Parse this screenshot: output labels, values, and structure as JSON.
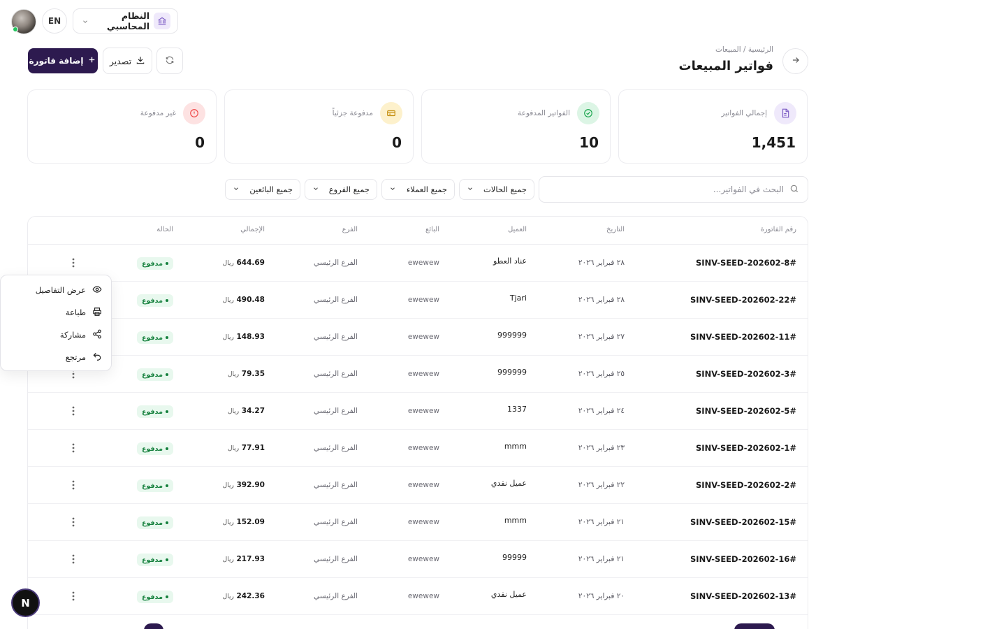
{
  "topbar": {
    "lang_label": "EN",
    "system_label": "النظام المحاسبي"
  },
  "header": {
    "breadcrumb": "الرئيسية / المبيعات",
    "title": "فواتير المبيعات",
    "export_label": "تصدير",
    "add_label": "إضافة فاتورة"
  },
  "stats": [
    {
      "label": "إجمالي الفواتير",
      "value": "1,451",
      "color": "#7c5cc4"
    },
    {
      "label": "الفواتير المدفوعة",
      "value": "10",
      "color": "#16a34a"
    },
    {
      "label": "مدفوعة جزئياً",
      "value": "0",
      "color": "#d4a017"
    },
    {
      "label": "غير مدفوعة",
      "value": "0",
      "color": "#ef4444"
    }
  ],
  "filters": {
    "search_placeholder": "البحث في الفواتير...",
    "status": "جميع الحالات",
    "customers": "جميع العملاء",
    "branches": "جميع الفروع",
    "sellers": "جميع البائعين"
  },
  "table": {
    "headers": {
      "invoice": "رقم الفاتورة",
      "date": "التاريخ",
      "customer": "العميل",
      "seller": "البائع",
      "branch": "الفرع",
      "total": "الإجمالي",
      "status": "الحالة"
    },
    "currency": "ريال",
    "rows": [
      {
        "invoice": "SINV-SEED-202602-8#",
        "date": "٢٨ فبراير ٢٠٢٦",
        "customer": "عناد العطو",
        "seller": "ewewew",
        "branch": "الفرع الرئيسي",
        "total": "644.69",
        "status": "مدفوع"
      },
      {
        "invoice": "SINV-SEED-202602-22#",
        "date": "٢٨ فبراير ٢٠٢٦",
        "customer": "Tjari",
        "seller": "ewewew",
        "branch": "الفرع الرئيسي",
        "total": "490.48",
        "status": "مدفوع"
      },
      {
        "invoice": "SINV-SEED-202602-11#",
        "date": "٢٧ فبراير ٢٠٢٦",
        "customer": "999999",
        "seller": "ewewew",
        "branch": "الفرع الرئيسي",
        "total": "148.93",
        "status": "مدفوع"
      },
      {
        "invoice": "SINV-SEED-202602-3#",
        "date": "٢٥ فبراير ٢٠٢٦",
        "customer": "999999",
        "seller": "ewewew",
        "branch": "الفرع الرئيسي",
        "total": "79.35",
        "status": "مدفوع"
      },
      {
        "invoice": "SINV-SEED-202602-5#",
        "date": "٢٤ فبراير ٢٠٢٦",
        "customer": "1337",
        "seller": "ewewew",
        "branch": "الفرع الرئيسي",
        "total": "34.27",
        "status": "مدفوع"
      },
      {
        "invoice": "SINV-SEED-202602-1#",
        "date": "٢٣ فبراير ٢٠٢٦",
        "customer": "mmm",
        "seller": "ewewew",
        "branch": "الفرع الرئيسي",
        "total": "77.91",
        "status": "مدفوع"
      },
      {
        "invoice": "SINV-SEED-202602-2#",
        "date": "٢٢ فبراير ٢٠٢٦",
        "customer": "عميل نقدي",
        "seller": "ewewew",
        "branch": "الفرع الرئيسي",
        "total": "392.90",
        "status": "مدفوع"
      },
      {
        "invoice": "SINV-SEED-202602-15#",
        "date": "٢١ فبراير ٢٠٢٦",
        "customer": "mmm",
        "seller": "ewewew",
        "branch": "الفرع الرئيسي",
        "total": "152.09",
        "status": "مدفوع"
      },
      {
        "invoice": "SINV-SEED-202602-16#",
        "date": "٢١ فبراير ٢٠٢٦",
        "customer": "99999",
        "seller": "ewewew",
        "branch": "الفرع الرئيسي",
        "total": "217.93",
        "status": "مدفوع"
      },
      {
        "invoice": "SINV-SEED-202602-13#",
        "date": "٢٠ فبراير ٢٠٢٦",
        "customer": "عميل نقدي",
        "seller": "ewewew",
        "branch": "الفرع الرئيسي",
        "total": "242.36",
        "status": "مدفوع"
      }
    ]
  },
  "context_menu": {
    "view": "عرض التفاصيل",
    "print": "طباعة",
    "share": "مشاركة",
    "return": "مرتجع"
  },
  "floating_badge": "N"
}
